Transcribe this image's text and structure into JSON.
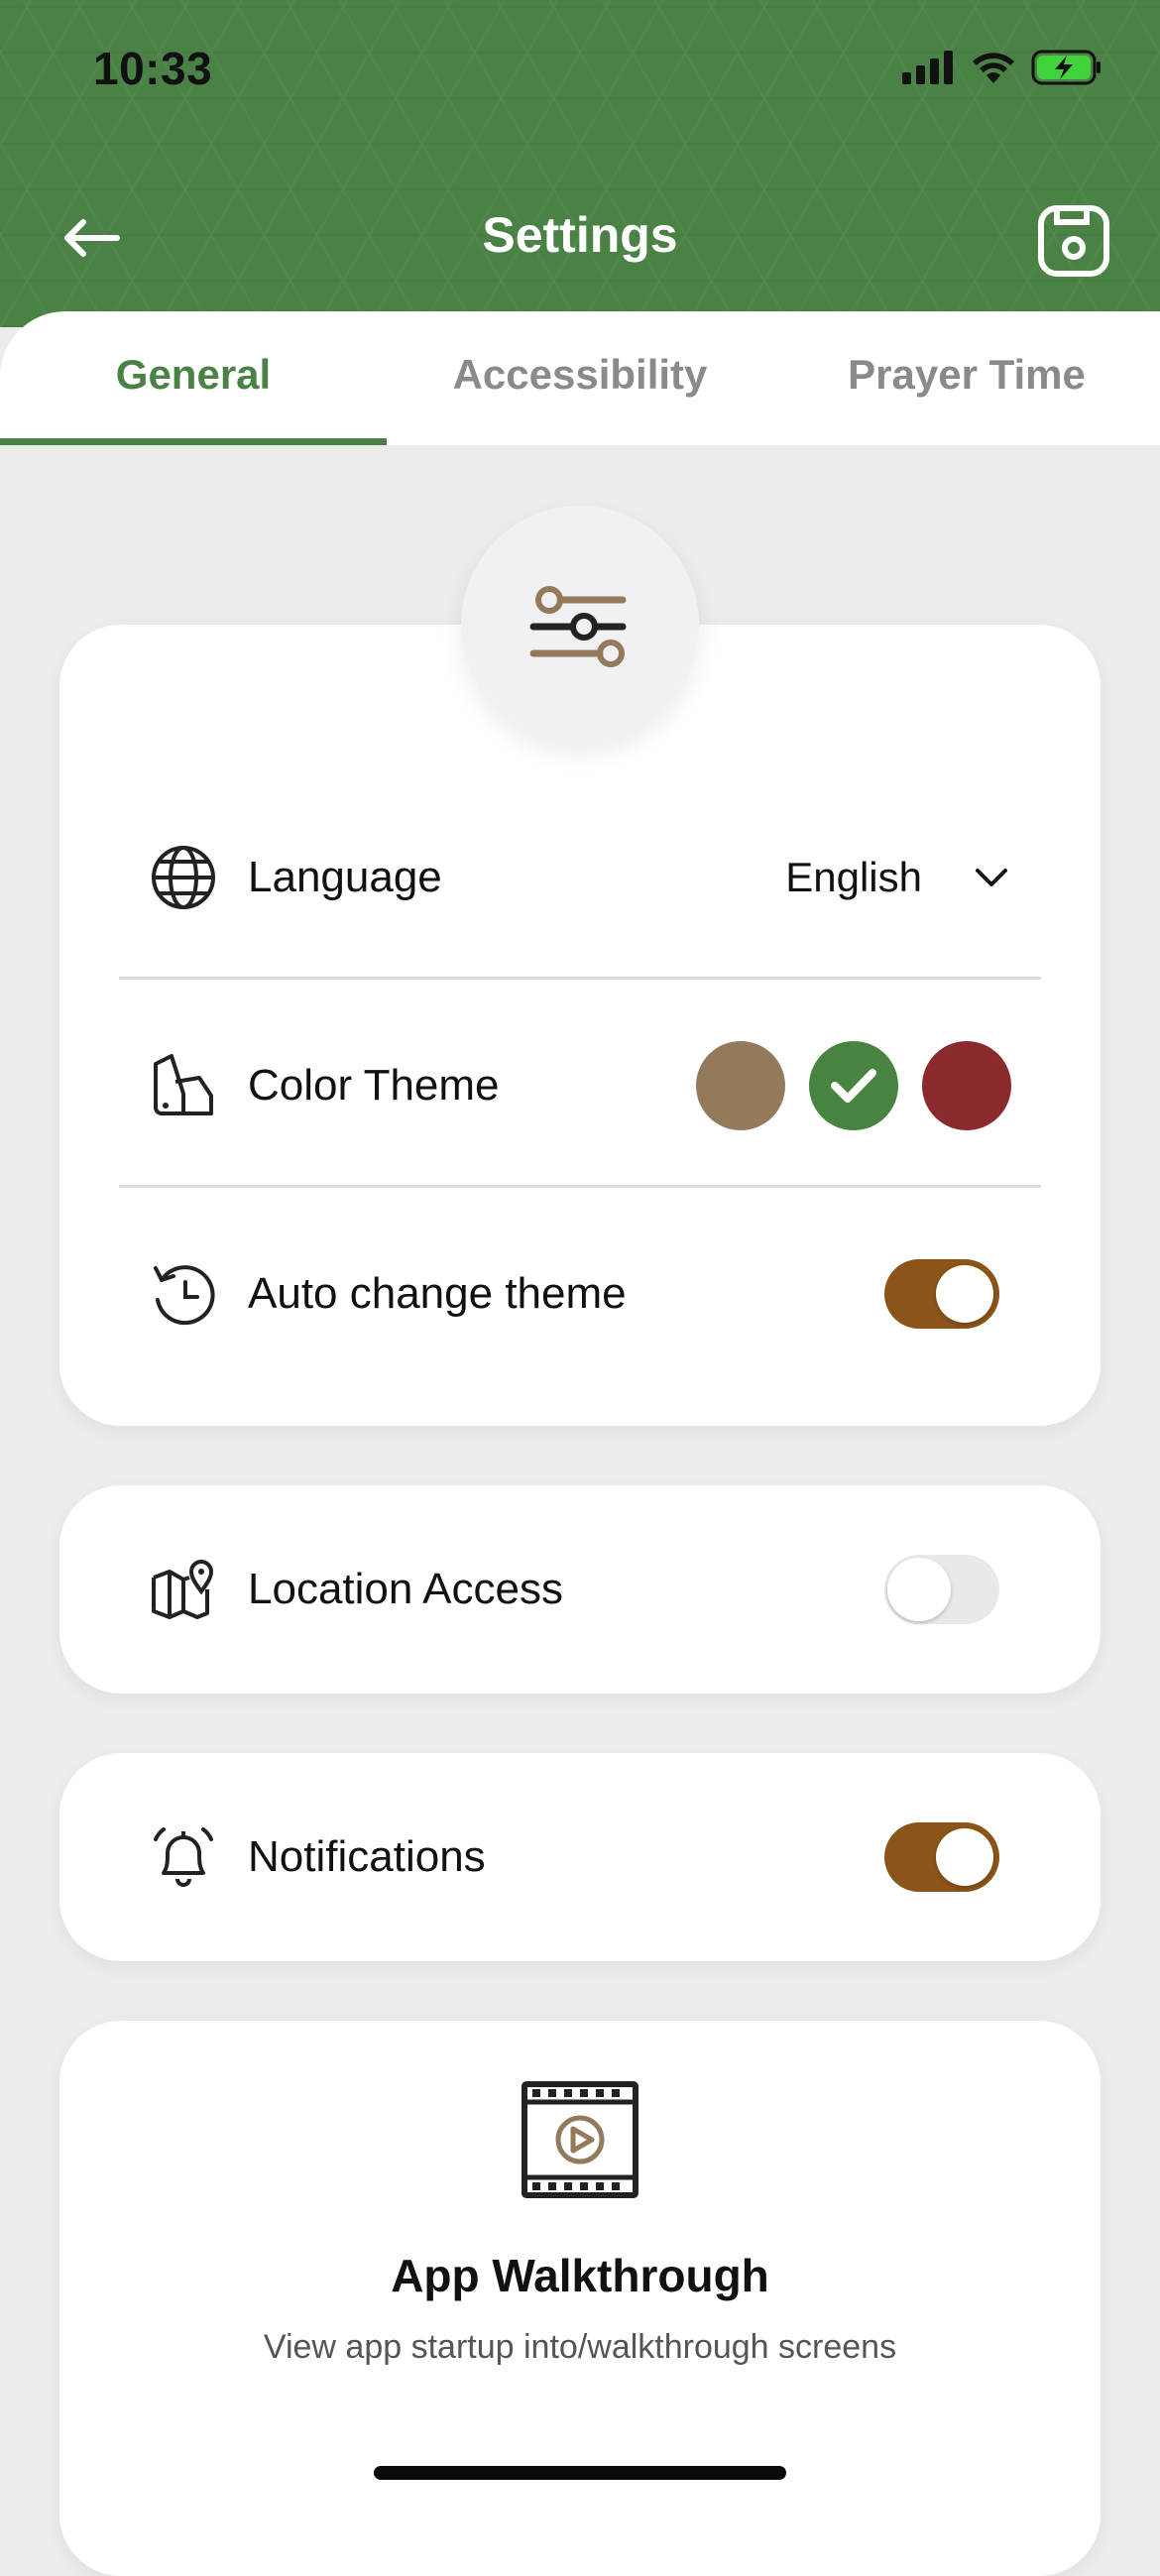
{
  "status_bar": {
    "time": "10:33"
  },
  "header": {
    "title": "Settings"
  },
  "tabs": [
    {
      "label": "General",
      "active": true
    },
    {
      "label": "Accessibility",
      "active": false
    },
    {
      "label": "Prayer Time",
      "active": false
    }
  ],
  "general": {
    "language": {
      "label": "Language",
      "value": "English"
    },
    "color_theme": {
      "label": "Color Theme",
      "options": [
        "#927a5b",
        "#46843f",
        "#8a2a2d"
      ],
      "selected_index": 1
    },
    "auto_change_theme": {
      "label": "Auto change theme",
      "enabled": true
    },
    "location_access": {
      "label": "Location Access",
      "enabled": false
    },
    "notifications": {
      "label": "Notifications",
      "enabled": true
    },
    "walkthrough": {
      "title": "App Walkthrough",
      "subtitle": "View app startup into/walkthrough screens"
    }
  },
  "colors": {
    "brand_green": "#4a8246",
    "toggle_on": "#8b5419",
    "accent_tan": "#927a5b"
  }
}
